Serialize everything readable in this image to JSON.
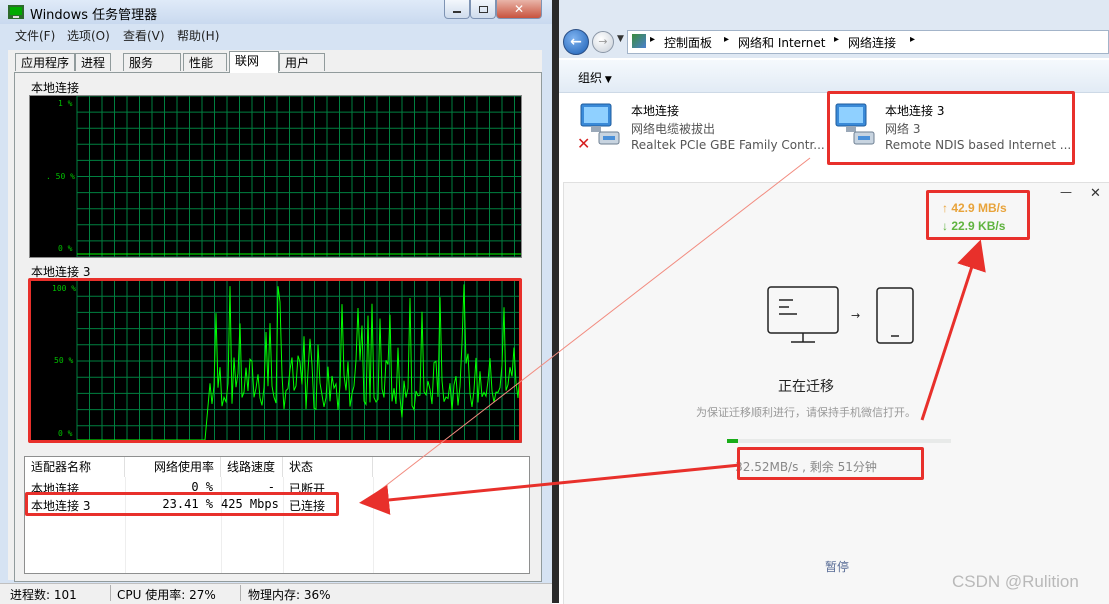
{
  "task_manager": {
    "title": "Windows 任务管理器",
    "menu": [
      "文件(F)",
      "选项(O)",
      "查看(V)",
      "帮助(H)"
    ],
    "tabs": [
      "应用程序",
      "进程",
      "服务",
      "性能",
      "联网",
      "用户"
    ],
    "active_tab": "联网",
    "graphs": [
      {
        "label": "本地连接",
        "ticks": [
          "1 %",
          ". 50 %",
          "0 %"
        ]
      },
      {
        "label": "本地连接 3",
        "ticks": [
          "100 %",
          "50 %",
          "0 %"
        ]
      }
    ],
    "table": {
      "headers": [
        "适配器名称",
        "网络使用率",
        "线路速度",
        "状态"
      ],
      "rows": [
        {
          "name": "本地连接",
          "usage": "0 %",
          "speed": "-",
          "status": "已断开"
        },
        {
          "name": "本地连接 3",
          "usage": "23.41 %",
          "speed": "425 Mbps",
          "status": "已连接"
        }
      ]
    },
    "status": {
      "processes": "进程数: 101",
      "cpu": "CPU 使用率: 27%",
      "memory": "物理内存: 36%"
    }
  },
  "explorer": {
    "breadcrumbs": [
      "控制面板",
      "网络和 Internet",
      "网络连接"
    ],
    "toolbar_organize": "组织",
    "connections": [
      {
        "name": "本地连接",
        "line2": "网络电缆被拔出",
        "line3": "Realtek PCIe GBE Family Contr..."
      },
      {
        "name": "本地连接 3",
        "line2": "网络  3",
        "line3": "Remote NDIS based Internet ..."
      }
    ]
  },
  "migration_dialog": {
    "upload_speed": "↑ 42.9 MB/s",
    "download_speed": "↓ 22.9 KB/s",
    "title": "正在迁移",
    "hint": "为保证迁移顺利进行，请保持手机微信打开。",
    "progress_text": "32.52MB/s , 剩余 51分钟",
    "progress": 0.05,
    "pause_label": "暂停",
    "minimize": "—",
    "close": "✕"
  },
  "watermark": "CSDN @Rulition",
  "colors": {
    "highlight": "#e8302b",
    "graph_green": "#00ff00",
    "grid_green": "#008040",
    "upload": "#e8a33a",
    "download": "#5fb33f",
    "progress": "#1aad19"
  }
}
